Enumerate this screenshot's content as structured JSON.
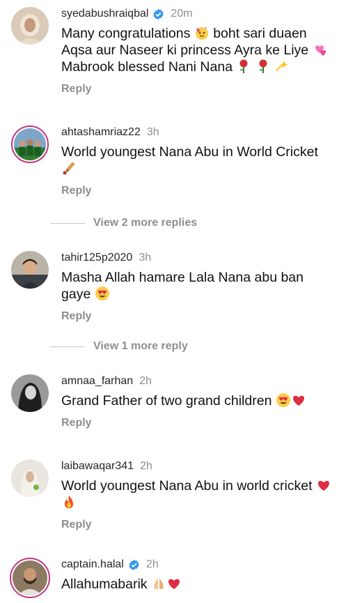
{
  "comments": [
    {
      "username": "syedabushraiqbal",
      "verified": true,
      "time": "20m",
      "text_parts": [
        "Many congratulations ",
        " boht sari duaen Aqsa aur Naseer ki princess Ayra ke Liye ",
        " Mabrook blessed Nani Nana ",
        " ",
        " "
      ],
      "emojis": [
        "partying-face-emoji",
        "heart-emoji",
        "rose-emoji",
        "rose-emoji",
        "dizzy-emoji"
      ],
      "reply_label": "Reply"
    },
    {
      "username": "ahtashamriaz22",
      "verified": false,
      "time": "3h",
      "text_parts": [
        "World youngest Nana Abu in World Cricket "
      ],
      "emojis": [
        "cricket-emoji"
      ],
      "reply_label": "Reply",
      "more_replies": "View 2 more replies"
    },
    {
      "username": "tahir125p2020",
      "verified": false,
      "time": "3h",
      "text_parts": [
        "Masha Allah hamare Lala Nana abu ban gaye "
      ],
      "emojis": [
        "heart-eyes-emoji"
      ],
      "reply_label": "Reply",
      "more_replies": "View 1 more reply"
    },
    {
      "username": "amnaa_farhan",
      "verified": false,
      "time": "2h",
      "text_parts": [
        "Grand Father of two grand children "
      ],
      "emojis": [
        "heart-eyes-emoji",
        "red-heart-emoji"
      ],
      "reply_label": "Reply"
    },
    {
      "username": "laibawaqar341",
      "verified": false,
      "time": "2h",
      "text_parts": [
        "World youngest Nana Abu in world cricket "
      ],
      "emojis": [
        "red-heart-emoji",
        "fire-emoji"
      ],
      "reply_label": "Reply"
    },
    {
      "username": "captain.halal",
      "verified": true,
      "time": "2h",
      "text_parts": [
        "Allahumabarik "
      ],
      "emojis": [
        "folded-hands-emoji",
        "red-heart-emoji"
      ]
    }
  ],
  "colors": {
    "verified_blue": "#3897f0",
    "muted_text": "#8e8e8e",
    "story_ring": "#c13584"
  }
}
